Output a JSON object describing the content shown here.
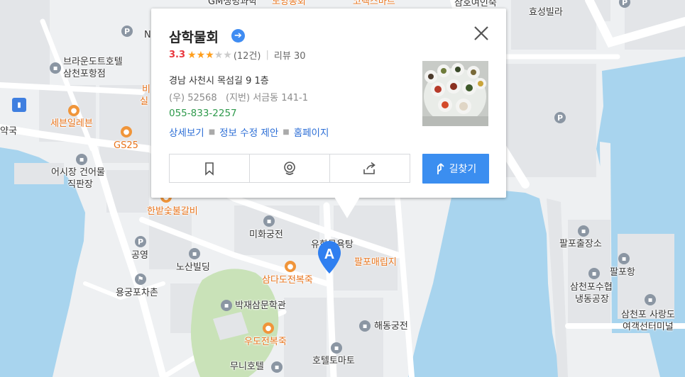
{
  "place": {
    "name": "삼학물회",
    "score": "3.3",
    "rating": 3.3,
    "review_count": "(12건)",
    "review_text": "리뷰 30",
    "address": "경남 사천시 목섬길 9 1층",
    "postal": "(우) 52568",
    "jibun": "(지번) 서금동 141-1",
    "phone": "055-833-2257",
    "links": [
      "상세보기",
      "정보 수정 제안",
      "홈페이지"
    ],
    "route_label": "길찾기",
    "marker_label": "A"
  },
  "map_labels": {
    "gm": "GM생명과학",
    "doyang": "도양동회",
    "corex": "코렉스마트",
    "samho": "삼호여인숙",
    "hyoseong": "효성빌라",
    "brown1": "브라운도트호텔",
    "brown2": "삼천포항점",
    "bi": "비",
    "sil": "실",
    "yak": "약국",
    "seven": "세븐일레븐",
    "gs25": "GS25",
    "eosijang1": "어시장 건어물",
    "eosijang2": "직판장",
    "hanbat": "한밭숯불갈비",
    "mihwa": "미화궁전",
    "yuhwa": "유화목욕탕",
    "palpo_maeip": "팔포매립지",
    "palpo_chul": "팔포출장소",
    "palpo_hang": "팔포항",
    "suhyup1": "삼천포수협",
    "suhyup2": "냉동공장",
    "sarang1": "삼천포 사랑도",
    "sarang2": "여객선터미널",
    "gongyeong": "공영",
    "nosan": "노산빌딩",
    "yonggung": "용궁포차촌",
    "samdado": "삼다도전복죽",
    "bakjae": "박재삼문학관",
    "udo": "우도전복죽",
    "haedong": "해동궁전",
    "hotel_toma": "호텔토마토",
    "muni": "무니호텔",
    "n_label": "N"
  },
  "colors": {
    "water": "#a8d4ee",
    "land": "#eef0f2",
    "block": "#e3e5e8",
    "road": "#ffffff",
    "park": "#c9e2b8",
    "route_button": "#3b8ef0",
    "marker": "#2f7ff0",
    "score": "#e8363d",
    "phone": "#2f9a4c",
    "link": "#2c6ed6"
  },
  "icons": [
    "bookmark-icon",
    "roadview-icon",
    "share-icon",
    "route-icon",
    "close-icon",
    "arrow-right-icon"
  ]
}
